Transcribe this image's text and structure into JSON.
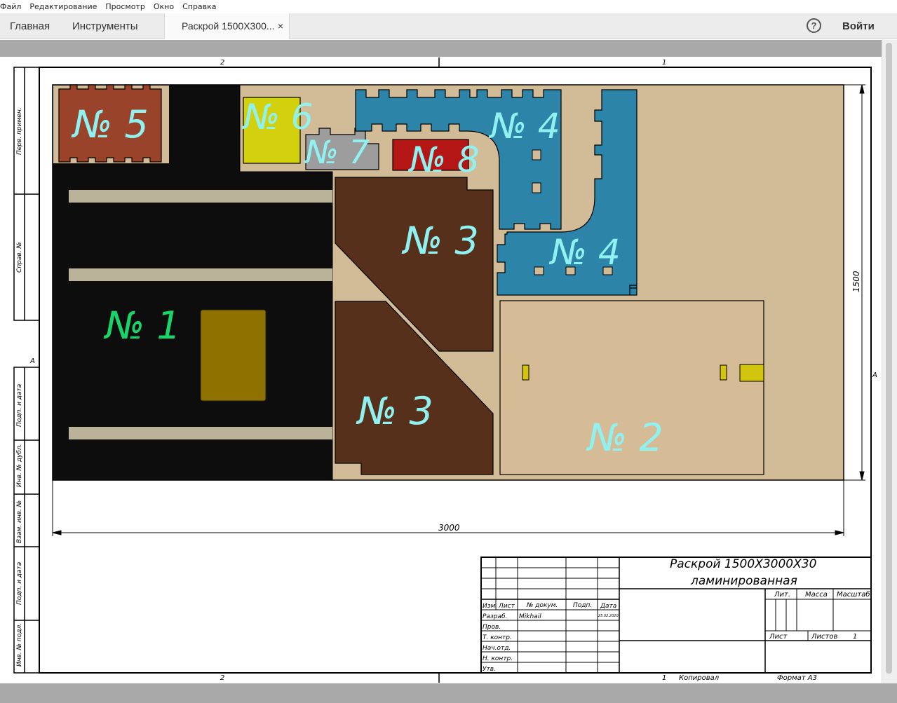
{
  "menu": {
    "file": "Файл",
    "edit": "Редактирование",
    "view": "Просмотр",
    "window": "Окно",
    "help": "Справка"
  },
  "tabs": {
    "home": "Главная",
    "tools": "Инструменты",
    "document": "Раскрой 1500Х300...",
    "close": "×"
  },
  "header": {
    "help_icon": "?",
    "login": "Войти"
  },
  "drawing": {
    "zone_top_left": "2",
    "zone_top_right": "1",
    "zone_bottom_left": "2",
    "zone_bottom_right": "1",
    "zone_side_left": "А",
    "zone_side_right": "А",
    "dim_width": "3000",
    "dim_height": "1500",
    "side_labels": [
      "Перв. примен.",
      "Справ. №",
      "Подп. и дата",
      "Инв. № дубл.",
      "Взам. инв. №",
      "Подп. и дата",
      "Инв. № подл."
    ],
    "parts": {
      "p1": "№ 1",
      "p2": "№ 2",
      "p3a": "№ 3",
      "p3b": "№ 3",
      "p4a": "№ 4",
      "p4b": "№ 4",
      "p5": "№ 5",
      "p6": "№ 6",
      "p7": "№ 7",
      "p8": "№ 8"
    }
  },
  "title_block": {
    "title_line1": "Раскрой 1500Х3000Х30",
    "title_line2": "ламинированная",
    "col_izm": "Изм",
    "col_list": "Лист",
    "col_doc": "№ докум.",
    "col_podp": "Подп.",
    "col_date": "Дата",
    "row_razrab": "Разраб.",
    "razrab_name": "Mikhail",
    "razrab_date": "25.02.2020",
    "row_prov": "Пров.",
    "row_tkontr": "Т. контр.",
    "row_nachotd": "Нач.отд.",
    "row_nkontr": "Н. контр.",
    "row_utv": "Утв.",
    "lit": "Лит.",
    "massa": "Масса",
    "masshtab": "Масштаб",
    "sheet_label": "Лист",
    "sheets_label": "Листов",
    "sheets_value": "1",
    "copied": "Копировал",
    "format": "Формат А3",
    "sheet_num": "1"
  },
  "colors": {
    "board": "#d2bc98",
    "p1": "#0d0d0d",
    "p2": "#d5bc97",
    "p3": "#56301a",
    "p4": "#2c84a8",
    "p5": "#9a432b",
    "p6": "#d3d00e",
    "p7": "#9d9d9d",
    "p8": "#b41616",
    "label_cyan": "#8ff2f0",
    "label_green": "#19d469"
  }
}
